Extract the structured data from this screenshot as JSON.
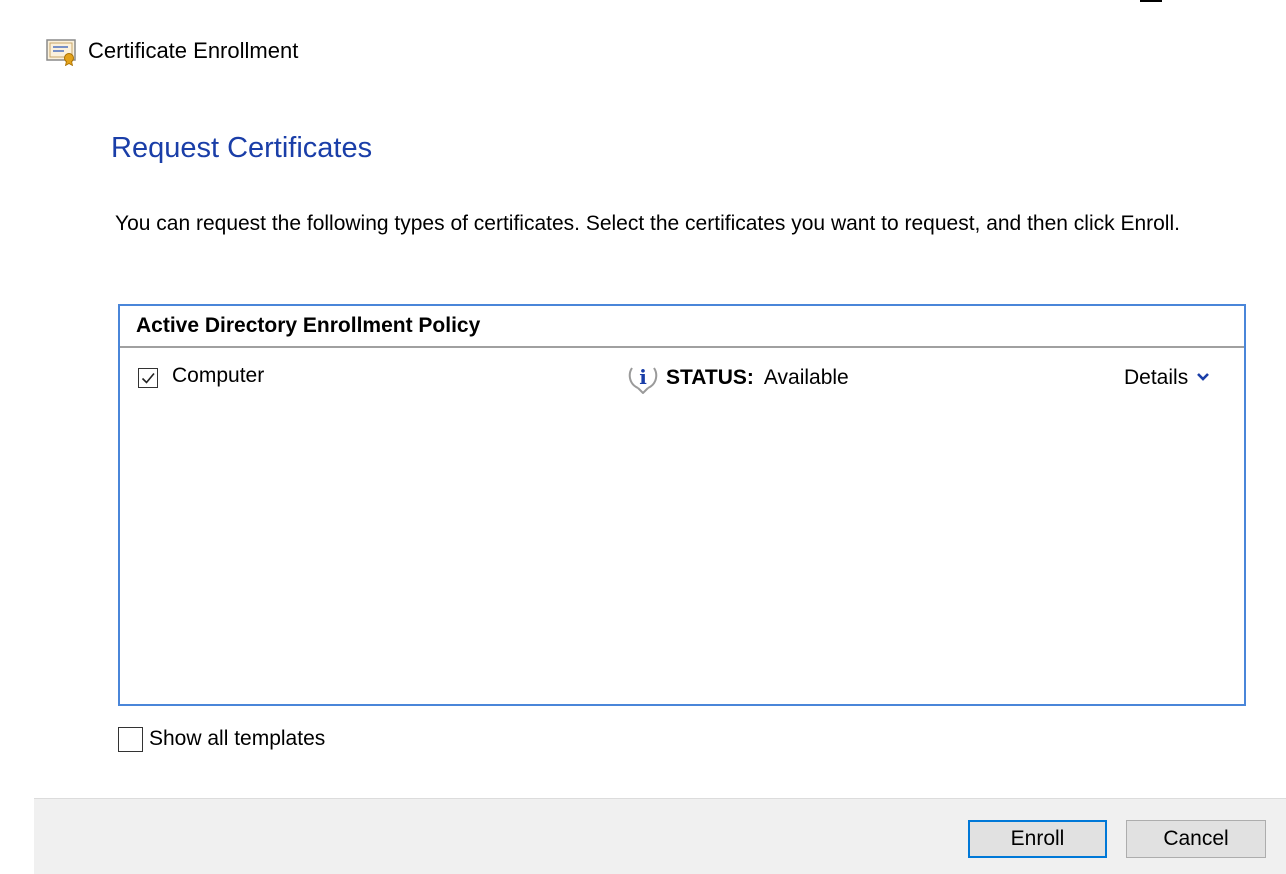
{
  "window": {
    "title": "Certificate Enrollment",
    "title_icon": "certificate-icon",
    "caption_close_glyph": "×"
  },
  "page": {
    "heading": "Request Certificates",
    "description": "You can request the following types of certificates. Select the certificates you want to request, and then click Enroll."
  },
  "policy": {
    "header": "Active Directory Enrollment Policy",
    "items": [
      {
        "checked": true,
        "label": "Computer",
        "status_icon": "info-icon",
        "status_label": "STATUS:",
        "status_value": "Available",
        "details_label": "Details",
        "details_icon": "chevron-down-icon"
      }
    ]
  },
  "options": {
    "show_all_templates": {
      "checked": false,
      "label": "Show all templates"
    }
  },
  "buttons": {
    "enroll": "Enroll",
    "cancel": "Cancel"
  },
  "colors": {
    "heading": "#1a3ea8",
    "box_border": "#4a86d9",
    "chevron": "#1a3ea8",
    "default_button_border": "#0078d7",
    "footer_bg": "#f0f0f0"
  }
}
